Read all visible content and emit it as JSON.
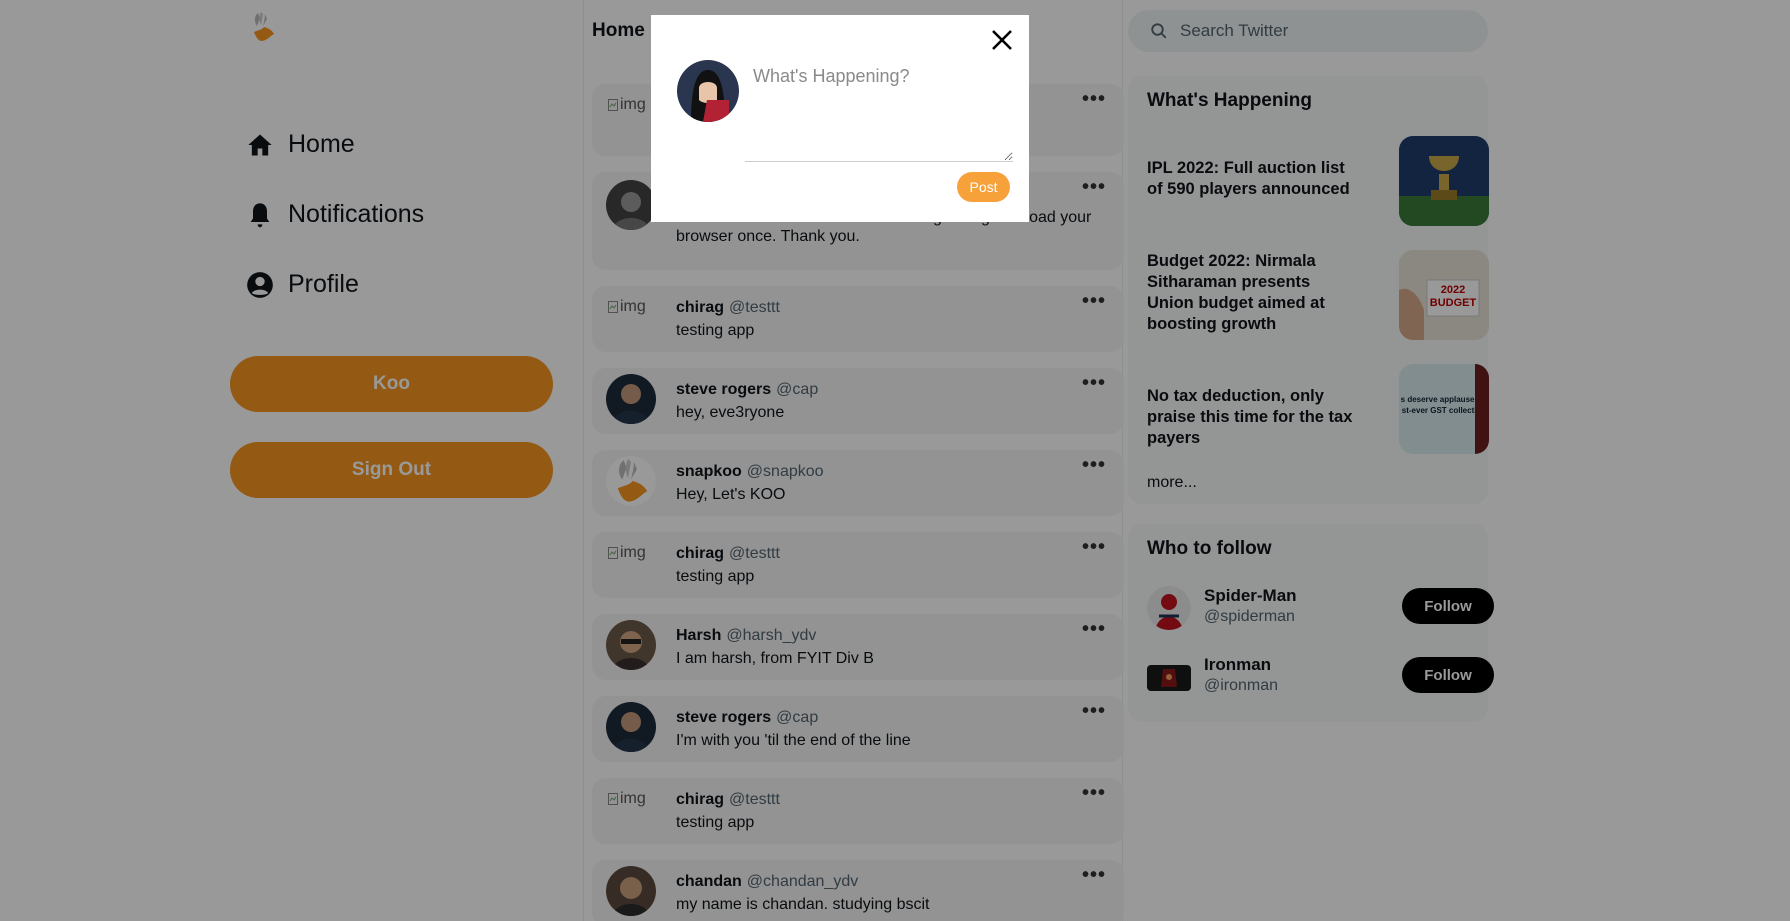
{
  "brand": {
    "accent": "#f79421",
    "logo_icon": "koo-bird-icon"
  },
  "nav": [
    {
      "label": "Home",
      "icon": "home-icon"
    },
    {
      "label": "Notifications",
      "icon": "bell-icon"
    },
    {
      "label": "Profile",
      "icon": "user-circle-icon"
    }
  ],
  "sidebar": {
    "koo_label": "Koo",
    "signout_label": "Sign Out"
  },
  "feed": {
    "title": "Home",
    "posts": [
      {
        "name": "",
        "handle": "",
        "text": "",
        "avatar": "img"
      },
      {
        "name": "",
        "handle": "",
        "text": "ader also. But make sure After saving changes reload your browser once. Thank you.",
        "avatar": "photo"
      },
      {
        "name": "chirag",
        "handle": "@testtt",
        "text": "testing app",
        "avatar": "img"
      },
      {
        "name": "steve rogers",
        "handle": "@cap",
        "text": "hey, eve3ryone",
        "avatar": "photo"
      },
      {
        "name": "snapkoo",
        "handle": "@snapkoo",
        "text": "Hey, Let's KOO",
        "avatar": "logo"
      },
      {
        "name": "chirag",
        "handle": "@testtt",
        "text": "testing app",
        "avatar": "img"
      },
      {
        "name": "Harsh",
        "handle": "@harsh_ydv",
        "text": "I am harsh, from FYIT Div B",
        "avatar": "photo"
      },
      {
        "name": "steve rogers",
        "handle": "@cap",
        "text": "I'm with you 'til the end of the line",
        "avatar": "photo"
      },
      {
        "name": "chirag",
        "handle": "@testtt",
        "text": "testing app",
        "avatar": "img"
      },
      {
        "name": "chandan",
        "handle": "@chandan_ydv",
        "text": "my name is chandan. studying bscit",
        "avatar": "photo"
      }
    ]
  },
  "search": {
    "placeholder": "Search Twitter"
  },
  "happening": {
    "title": "What's Happening",
    "items": [
      {
        "text": "IPL 2022: Full auction list of 590 players announced"
      },
      {
        "text": "Budget 2022: Nirmala Sitharaman presents Union budget aimed at boosting growth",
        "thumb_label": "2022 BUDGET"
      },
      {
        "text": "No tax deduction, only praise this time for the tax payers",
        "thumb_label": "s deserve applause for st-ever GST collection"
      }
    ],
    "more_label": "more..."
  },
  "who_to_follow": {
    "title": "Who to follow",
    "users": [
      {
        "name": "Spider-Man",
        "handle": "@spiderman",
        "button": "Follow"
      },
      {
        "name": "Ironman",
        "handle": "@ironman",
        "button": "Follow"
      }
    ]
  },
  "composer": {
    "placeholder": "What's Happening?",
    "post_label": "Post",
    "close_icon": "close-icon"
  },
  "broken_img_alt": "img"
}
